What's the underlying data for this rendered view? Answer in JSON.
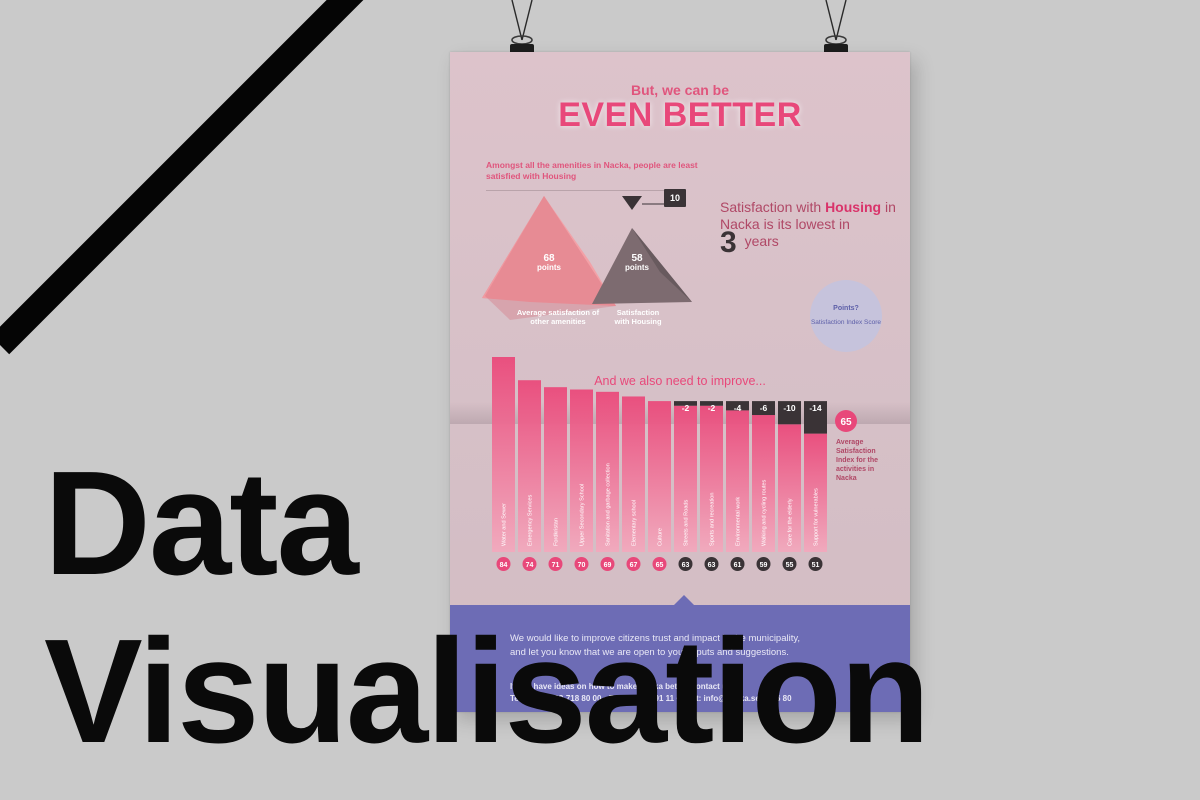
{
  "poster": {
    "lead_in": "But, we can be",
    "headline": "EVEN BETTER",
    "intro": "Amongst all the amenities in Nacka, people are least satisfied with Housing",
    "triangles": {
      "left_value": "68",
      "left_unit": "points",
      "left_caption": "Average satisfaction of other amenities",
      "right_value": "58",
      "right_unit": "points",
      "right_caption": "Satisfaction with Housing",
      "difference": "10"
    },
    "statement": {
      "part1": "Satisfaction with ",
      "highlight": "Housing",
      "part2": " in Nacka is its lowest in ",
      "number": "3",
      "part3": " years"
    },
    "points_note": {
      "title": "Points?",
      "text": "Satisfaction Index Score"
    },
    "improve_title": "And we also need to improve...",
    "average": {
      "value": "65",
      "label": "Average Satisfaction Index for the activities in Nacka"
    },
    "footer": {
      "line1": "We would like to improve citizens trust and impact in the municipality,",
      "line2": "and let you know that we are open to your inputs and suggestions.",
      "line3": "If you have ideas on how to make Nacka better, contact us:",
      "line4": "Telephone: 08-718 80 00  •  Fax: 08-718 91 11  •  Post: info@nacka.se  •  716 80"
    }
  },
  "colors": {
    "background": "#cacaca",
    "poster": "#d8c0c8",
    "accent_pink": "#e8487a",
    "dark": "#3a3336",
    "footer": "#6d6cb5"
  },
  "chart_data": {
    "type": "bar",
    "title": "And we also need to improve...",
    "categories": [
      "Water and Sewer",
      "Emergency Services",
      "Fordkristan",
      "Upper Secondary School",
      "Sanitation and garbage collection",
      "Elementary school",
      "Culture",
      "Streets and Roads",
      "Sports and recreation",
      "Environmental work",
      "Walking and cycling routes",
      "Care for the elderly",
      "Support for vulnerables"
    ],
    "values": [
      84,
      74,
      71,
      70,
      69,
      67,
      65,
      63,
      63,
      61,
      59,
      55,
      51
    ],
    "average": 65,
    "differences_from_average": [
      null,
      null,
      null,
      null,
      null,
      null,
      null,
      -2,
      -2,
      -4,
      -6,
      -10,
      -14
    ],
    "difference_labels": [
      "",
      "",
      "",
      "",
      "",
      "",
      "",
      "-2",
      "-2",
      "-4",
      "-6",
      "-10",
      "-14"
    ]
  },
  "overlay": {
    "title_line1": "Data",
    "title_line2": "Visualisation"
  }
}
